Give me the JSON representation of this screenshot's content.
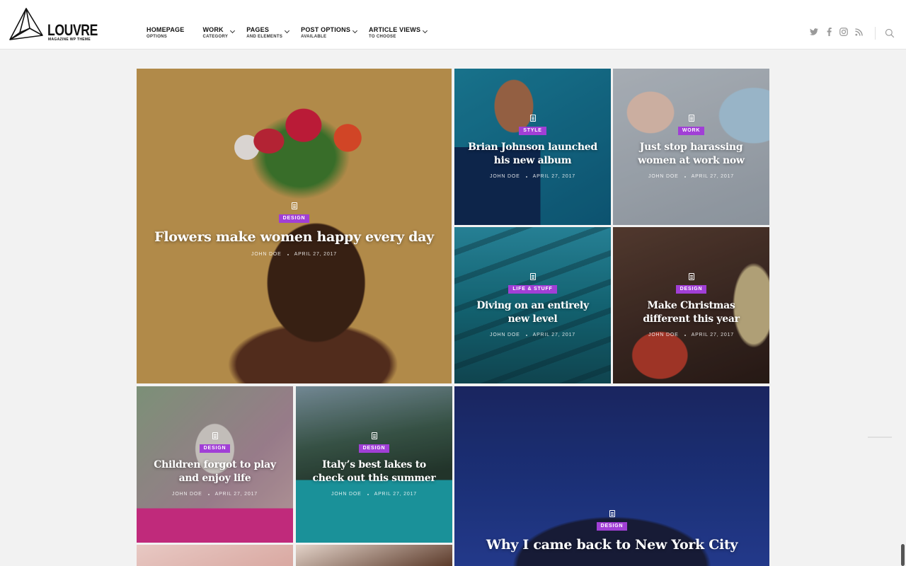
{
  "brand": {
    "name": "LOUVRE",
    "tagline": "MAGAZINE WP THEME"
  },
  "nav": [
    {
      "label": "HOMEPAGE",
      "sub": "OPTIONS"
    },
    {
      "label": "WORK",
      "sub": "CATEGORY"
    },
    {
      "label": "PAGES",
      "sub": "AND ELEMENTS"
    },
    {
      "label": "POST OPTIONS",
      "sub": "AVAILABLE"
    },
    {
      "label": "ARTICLE VIEWS",
      "sub": "TO CHOOSE"
    }
  ],
  "social": [
    "twitter-icon",
    "facebook-icon",
    "instagram-icon",
    "rss-icon"
  ],
  "accent": "#a13fd6",
  "posts": [
    {
      "category": "DESIGN",
      "title": "Flowers make women happy every day",
      "author": "JOHN DOE",
      "date": "APRIL 27, 2017"
    },
    {
      "category": "STYLE",
      "title": "Brian Johnson launched his new album",
      "author": "JOHN DOE",
      "date": "APRIL 27, 2017"
    },
    {
      "category": "WORK",
      "title": "Just stop harassing women at work now",
      "author": "JOHN DOE",
      "date": "APRIL 27, 2017"
    },
    {
      "category": "LIFE & STUFF",
      "title": "Diving on an entirely new level",
      "author": "JOHN DOE",
      "date": "APRIL 27, 2017"
    },
    {
      "category": "DESIGN",
      "title": "Make Christmas different this year",
      "author": "JOHN DOE",
      "date": "APRIL 27, 2017"
    },
    {
      "category": "DESIGN",
      "title": "Children forgot to play and enjoy life",
      "author": "JOHN DOE",
      "date": "APRIL 27, 2017"
    },
    {
      "category": "DESIGN",
      "title": "Italy’s best lakes to check out this summer",
      "author": "JOHN DOE",
      "date": "APRIL 27, 2017"
    },
    {
      "category": "DESIGN",
      "title": "Why I came back to New York City"
    }
  ]
}
